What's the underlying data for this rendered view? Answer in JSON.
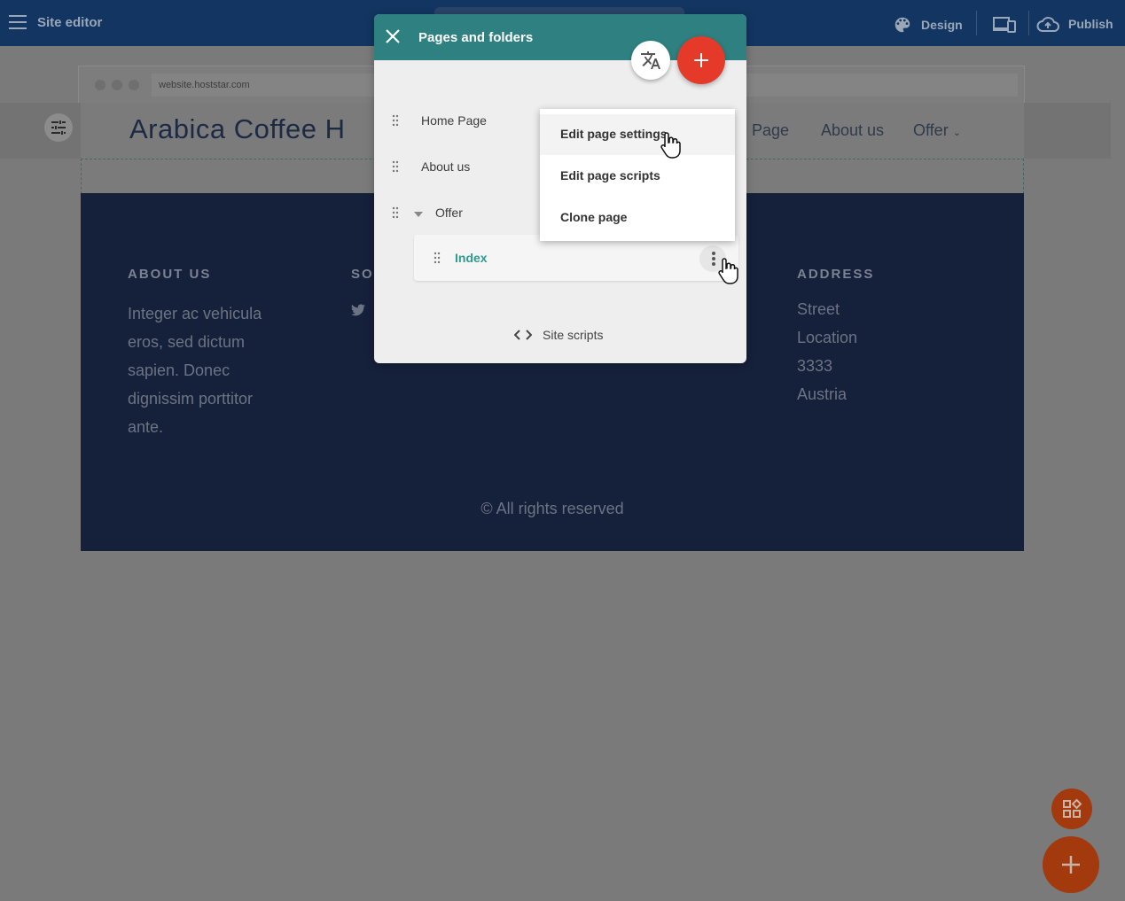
{
  "topbar": {
    "title": "Site editor",
    "design_label": "Design",
    "publish_label": "Publish"
  },
  "browser": {
    "url": "website.hoststar.com"
  },
  "site": {
    "logo": "Arabica Coffee H",
    "nav": [
      "e Page",
      "About us",
      "Offer"
    ]
  },
  "footer": {
    "about_heading": "ABOUT US",
    "about_text": [
      "Integer ac vehicula",
      "eros, sed dictum",
      "sapien. Donec",
      "dignissim porttitor",
      "ante."
    ],
    "social_heading": "SO",
    "address_heading": "ADDRESS",
    "address_lines": [
      "Street",
      "Location",
      "3333",
      "Austria"
    ],
    "copyright": "© All rights reserved"
  },
  "modal": {
    "title": "Pages and folders",
    "pages": [
      {
        "label": "Home Page"
      },
      {
        "label": "About us"
      },
      {
        "label": "Offer"
      }
    ],
    "active_page": "Index",
    "site_scripts_label": "Site scripts"
  },
  "context_menu": {
    "items": [
      "Edit page settings",
      "Edit page scripts",
      "Clone page"
    ]
  },
  "colors": {
    "topbar": "#123561",
    "modal_header": "#2f8080",
    "fab_red": "#e53a2a",
    "active_text": "#2f9a8e",
    "footer_bg": "#15203a"
  }
}
